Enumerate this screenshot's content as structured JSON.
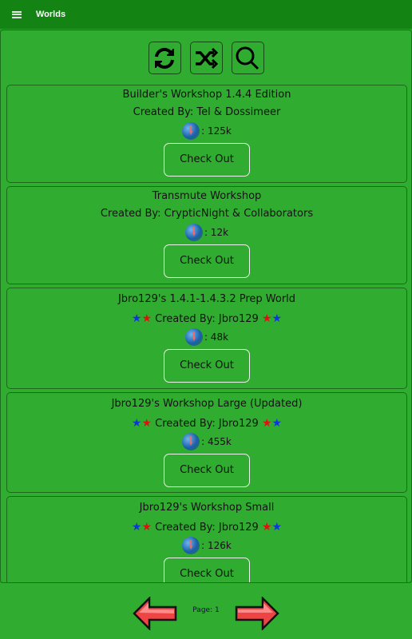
{
  "header": {
    "title": "Worlds",
    "menu_icon": "hamburger-menu-icon"
  },
  "toolbar": {
    "buttons": [
      {
        "icon": "refresh-icon"
      },
      {
        "icon": "shuffle-icon"
      },
      {
        "icon": "search-icon"
      }
    ]
  },
  "worlds": [
    {
      "name": "Builder's Workshop 1.4.4 Edition",
      "creator": "Created By:  Tel & Dossimeer",
      "downloads": ": 125k",
      "button": "Check Out",
      "stars": false
    },
    {
      "name": "Transmute Workshop",
      "creator": "Created By:  CrypticNight & Collaborators",
      "downloads": ": 12k",
      "button": "Check Out",
      "stars": false
    },
    {
      "name": "Jbro129's 1.4.1-1.4.3.2 Prep World",
      "creator": "Created By: Jbro129",
      "downloads": ": 48k",
      "button": "Check Out",
      "stars": true
    },
    {
      "name": "Jbro129's Workshop Large (Updated)",
      "creator": "Created By: Jbro129",
      "downloads": ": 455k",
      "button": "Check Out",
      "stars": true
    },
    {
      "name": "Jbro129's Workshop Small",
      "creator": "Created By: Jbro129",
      "downloads": ": 126k",
      "button": "Check Out",
      "stars": true
    }
  ],
  "footer": {
    "page_label": "Page: 1"
  },
  "colors": {
    "header": "#138413",
    "background": "#30ad30",
    "star_blue": "#1033e0",
    "star_red": "#e01010"
  }
}
